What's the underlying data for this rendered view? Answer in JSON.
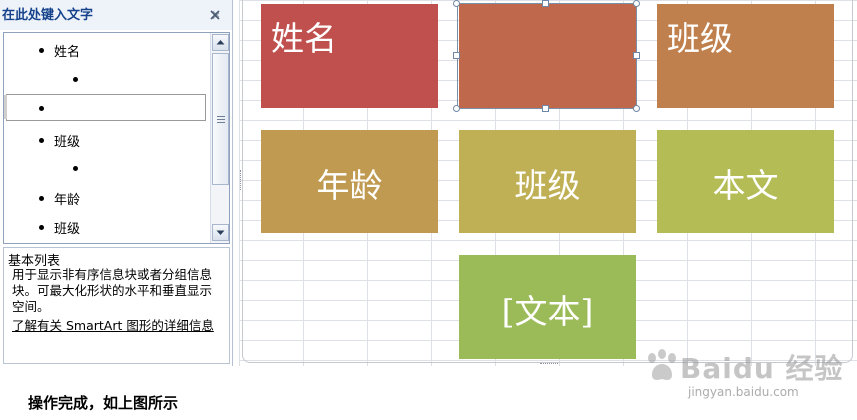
{
  "text_pane": {
    "title": "在此处键入文字",
    "items": [
      {
        "text": "姓名"
      },
      {
        "text": ""
      },
      {
        "text": ""
      },
      {
        "text": "班级"
      },
      {
        "text": ""
      },
      {
        "text": "年龄"
      },
      {
        "text": "班级"
      }
    ],
    "description": {
      "title": "基本列表",
      "body": "用于显示非有序信息块或者分组信息块。可最大化形状的水平和垂直显示空间。",
      "link": "了解有关 SmartArt 图形的详细信息"
    }
  },
  "shapes": [
    {
      "text": "姓名",
      "color": "#c0504d"
    },
    {
      "text": "",
      "color": "#c0684c"
    },
    {
      "text": "班级",
      "color": "#c0804d"
    },
    {
      "text": "年龄",
      "color": "#c09a50"
    },
    {
      "text": "班级",
      "color": "#c0b055"
    },
    {
      "text": "本文",
      "color": "#b3bc55"
    },
    {
      "text": "[文本]",
      "color": "#9bbb59"
    }
  ],
  "caption": "操作完成，如上图所示",
  "watermark": {
    "brand": "Baidu 经验",
    "url": "jingyan.baidu.com"
  }
}
